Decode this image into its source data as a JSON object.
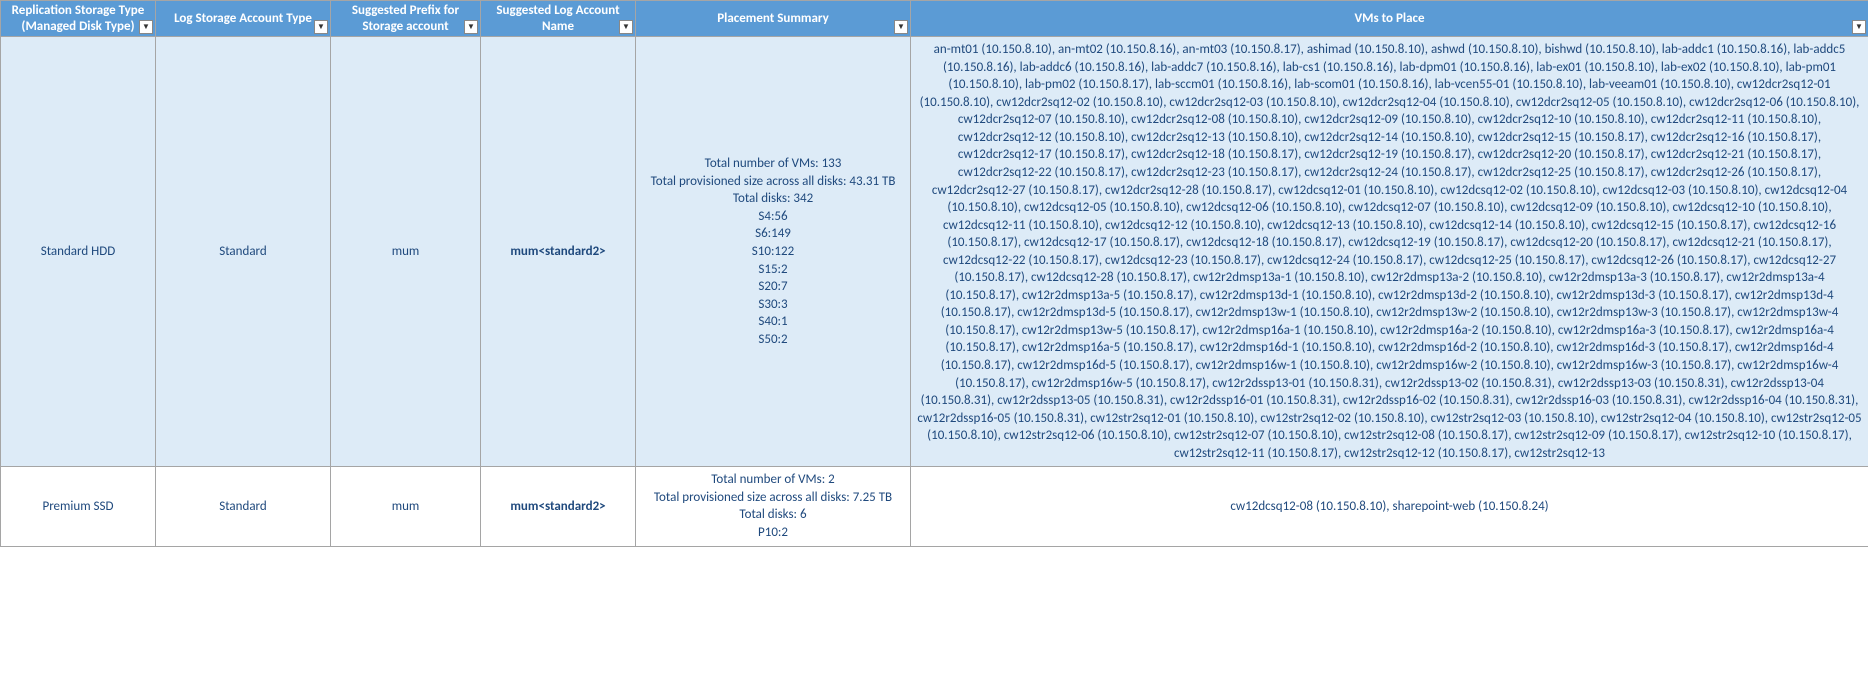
{
  "headers": {
    "replication": "Replication Storage Type (Managed Disk Type)",
    "log_type": "Log Storage Account Type",
    "prefix": "Suggested Prefix for Storage account",
    "log_name": "Suggested Log Account  Name",
    "summary": "Placement Summary",
    "vms": "VMs to Place"
  },
  "rows": [
    {
      "replication": "Standard HDD",
      "log_type": "Standard",
      "prefix": "mum",
      "log_name": "mum<standard2>",
      "summary": [
        "Total number of VMs: 133",
        "Total provisioned size across all disks: 43.31 TB",
        "Total disks: 342",
        "S4:56",
        "S6:149",
        "S10:122",
        "S15:2",
        "S20:7",
        "S30:3",
        "S40:1",
        "S50:2"
      ],
      "vms": "an-mt01 (10.150.8.10), an-mt02 (10.150.8.16), an-mt03 (10.150.8.17), ashimad (10.150.8.10), ashwd (10.150.8.10), bishwd (10.150.8.10), lab-addc1 (10.150.8.16), lab-addc5 (10.150.8.16), lab-addc6 (10.150.8.16), lab-addc7 (10.150.8.16), lab-cs1 (10.150.8.16), lab-dpm01 (10.150.8.16), lab-ex01 (10.150.8.10), lab-ex02 (10.150.8.10), lab-pm01 (10.150.8.10), lab-pm02 (10.150.8.17), lab-sccm01 (10.150.8.16), lab-scom01 (10.150.8.16), lab-vcen55-01 (10.150.8.10), lab-veeam01 (10.150.8.10), cw12dcr2sq12-01 (10.150.8.10), cw12dcr2sq12-02 (10.150.8.10), cw12dcr2sq12-03 (10.150.8.10), cw12dcr2sq12-04 (10.150.8.10), cw12dcr2sq12-05 (10.150.8.10), cw12dcr2sq12-06 (10.150.8.10), cw12dcr2sq12-07 (10.150.8.10), cw12dcr2sq12-08 (10.150.8.10), cw12dcr2sq12-09 (10.150.8.10), cw12dcr2sq12-10 (10.150.8.10), cw12dcr2sq12-11 (10.150.8.10), cw12dcr2sq12-12 (10.150.8.10), cw12dcr2sq12-13 (10.150.8.10), cw12dcr2sq12-14 (10.150.8.10), cw12dcr2sq12-15 (10.150.8.17), cw12dcr2sq12-16 (10.150.8.17), cw12dcr2sq12-17 (10.150.8.17), cw12dcr2sq12-18 (10.150.8.17), cw12dcr2sq12-19 (10.150.8.17), cw12dcr2sq12-20 (10.150.8.17), cw12dcr2sq12-21 (10.150.8.17), cw12dcr2sq12-22 (10.150.8.17), cw12dcr2sq12-23 (10.150.8.17), cw12dcr2sq12-24 (10.150.8.17), cw12dcr2sq12-25 (10.150.8.17), cw12dcr2sq12-26 (10.150.8.17), cw12dcr2sq12-27 (10.150.8.17), cw12dcr2sq12-28 (10.150.8.17), cw12dcsq12-01 (10.150.8.10), cw12dcsq12-02 (10.150.8.10), cw12dcsq12-03 (10.150.8.10), cw12dcsq12-04 (10.150.8.10), cw12dcsq12-05 (10.150.8.10), cw12dcsq12-06 (10.150.8.10), cw12dcsq12-07 (10.150.8.10), cw12dcsq12-09 (10.150.8.10), cw12dcsq12-10 (10.150.8.10), cw12dcsq12-11 (10.150.8.10), cw12dcsq12-12 (10.150.8.10), cw12dcsq12-13 (10.150.8.10), cw12dcsq12-14 (10.150.8.10), cw12dcsq12-15 (10.150.8.17), cw12dcsq12-16 (10.150.8.17), cw12dcsq12-17 (10.150.8.17), cw12dcsq12-18 (10.150.8.17), cw12dcsq12-19 (10.150.8.17), cw12dcsq12-20 (10.150.8.17), cw12dcsq12-21 (10.150.8.17), cw12dcsq12-22 (10.150.8.17), cw12dcsq12-23 (10.150.8.17), cw12dcsq12-24 (10.150.8.17), cw12dcsq12-25 (10.150.8.17), cw12dcsq12-26 (10.150.8.17), cw12dcsq12-27 (10.150.8.17), cw12dcsq12-28 (10.150.8.17), cw12r2dmsp13a-1 (10.150.8.10), cw12r2dmsp13a-2 (10.150.8.10), cw12r2dmsp13a-3 (10.150.8.17), cw12r2dmsp13a-4 (10.150.8.17), cw12r2dmsp13a-5 (10.150.8.17), cw12r2dmsp13d-1 (10.150.8.10), cw12r2dmsp13d-2 (10.150.8.10), cw12r2dmsp13d-3 (10.150.8.17), cw12r2dmsp13d-4 (10.150.8.17), cw12r2dmsp13d-5 (10.150.8.17), cw12r2dmsp13w-1 (10.150.8.10), cw12r2dmsp13w-2 (10.150.8.10), cw12r2dmsp13w-3 (10.150.8.17), cw12r2dmsp13w-4 (10.150.8.17), cw12r2dmsp13w-5 (10.150.8.17), cw12r2dmsp16a-1 (10.150.8.10), cw12r2dmsp16a-2 (10.150.8.10), cw12r2dmsp16a-3 (10.150.8.17), cw12r2dmsp16a-4 (10.150.8.17), cw12r2dmsp16a-5 (10.150.8.17), cw12r2dmsp16d-1 (10.150.8.10), cw12r2dmsp16d-2 (10.150.8.10), cw12r2dmsp16d-3 (10.150.8.17), cw12r2dmsp16d-4 (10.150.8.17), cw12r2dmsp16d-5 (10.150.8.17), cw12r2dmsp16w-1 (10.150.8.10), cw12r2dmsp16w-2 (10.150.8.10), cw12r2dmsp16w-3 (10.150.8.17), cw12r2dmsp16w-4 (10.150.8.17), cw12r2dmsp16w-5 (10.150.8.17), cw12r2dssp13-01 (10.150.8.31), cw12r2dssp13-02 (10.150.8.31), cw12r2dssp13-03 (10.150.8.31), cw12r2dssp13-04 (10.150.8.31), cw12r2dssp13-05 (10.150.8.31), cw12r2dssp16-01 (10.150.8.31), cw12r2dssp16-02 (10.150.8.31), cw12r2dssp16-03 (10.150.8.31), cw12r2dssp16-04 (10.150.8.31), cw12r2dssp16-05 (10.150.8.31), cw12str2sq12-01 (10.150.8.10), cw12str2sq12-02 (10.150.8.10), cw12str2sq12-03 (10.150.8.10), cw12str2sq12-04 (10.150.8.10), cw12str2sq12-05 (10.150.8.10), cw12str2sq12-06 (10.150.8.10), cw12str2sq12-07 (10.150.8.10), cw12str2sq12-08 (10.150.8.17), cw12str2sq12-09 (10.150.8.17), cw12str2sq12-10 (10.150.8.17), cw12str2sq12-11 (10.150.8.17), cw12str2sq12-12 (10.150.8.17), cw12str2sq12-13"
    },
    {
      "replication": "Premium SSD",
      "log_type": "Standard",
      "prefix": "mum",
      "log_name": "mum<standard2>",
      "summary": [
        "Total number of VMs: 2",
        "Total provisioned size across all disks: 7.25 TB",
        "Total disks: 6",
        "P10:2"
      ],
      "vms": "cw12dcsq12-08 (10.150.8.10), sharepoint-web (10.150.8.24)"
    }
  ]
}
